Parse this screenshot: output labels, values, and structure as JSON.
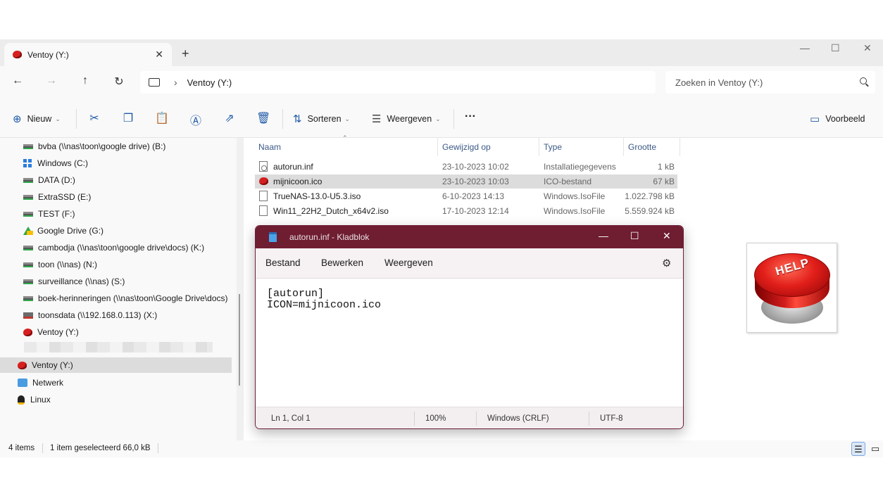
{
  "window": {
    "tab_title": "Ventoy (Y:)",
    "tab_close_glyph": "✕",
    "new_tab_glyph": "+",
    "minimize_glyph": "—",
    "maximize_glyph": "☐",
    "close_glyph": "✕"
  },
  "address": {
    "back_glyph": "←",
    "forward_glyph": "→",
    "up_glyph": "↑",
    "refresh_glyph": "↻",
    "separator": "›",
    "breadcrumb": "Ventoy (Y:)",
    "search_placeholder": "Zoeken in Ventoy (Y:)"
  },
  "toolbar": {
    "new_label": "Nieuw",
    "sort_label": "Sorteren",
    "view_label": "Weergeven",
    "more_glyph": "···",
    "preview_label": "Voorbeeld",
    "icons": [
      "cut-icon",
      "copy-icon",
      "paste-icon",
      "rename-icon",
      "share-icon",
      "delete-icon"
    ]
  },
  "sidebar": {
    "items": [
      {
        "label": "bvba (\\\\nas\\toon\\google drive) (B:)",
        "icon": "network-drive"
      },
      {
        "label": "Windows  (C:)",
        "icon": "windows-drive"
      },
      {
        "label": "DATA (D:)",
        "icon": "drive"
      },
      {
        "label": "ExtraSSD (E:)",
        "icon": "drive"
      },
      {
        "label": "TEST (F:)",
        "icon": "drive"
      },
      {
        "label": "Google Drive (G:)",
        "icon": "google-drive"
      },
      {
        "label": "cambodja (\\\\nas\\toon\\google drive\\docs) (K:)",
        "icon": "network-drive"
      },
      {
        "label": "toon (\\\\nas) (N:)",
        "icon": "network-drive"
      },
      {
        "label": "surveillance (\\\\nas) (S:)",
        "icon": "network-drive"
      },
      {
        "label": "boek-herinneringen (\\\\nas\\toon\\Google Drive\\docs)",
        "icon": "network-drive"
      },
      {
        "label": "toonsdata (\\\\192.168.0.113) (X:)",
        "icon": "disconnected-drive"
      },
      {
        "label": "Ventoy (Y:)",
        "icon": "ruby"
      }
    ],
    "tree": [
      {
        "label": "Ventoy (Y:)",
        "selected": true
      },
      {
        "label": "Netwerk"
      },
      {
        "label": "Linux"
      }
    ]
  },
  "filelist": {
    "columns": [
      "Naam",
      "Gewijzigd op",
      "Type",
      "Grootte"
    ],
    "rows": [
      {
        "name": "autorun.inf",
        "modified": "23-10-2023 10:02",
        "type": "Installatiegegevens",
        "size": "1 kB",
        "selected": false
      },
      {
        "name": "mijnicoon.ico",
        "modified": "23-10-2023 10:03",
        "type": "ICO-bestand",
        "size": "67 kB",
        "selected": true
      },
      {
        "name": "TrueNAS-13.0-U5.3.iso",
        "modified": "6-10-2023 14:13",
        "type": "Windows.IsoFile",
        "size": "1.022.798 kB",
        "selected": false
      },
      {
        "name": "Win11_22H2_Dutch_x64v2.iso",
        "modified": "17-10-2023 12:14",
        "type": "Windows.IsoFile",
        "size": "5.559.924 kB",
        "selected": false
      }
    ]
  },
  "statusbar": {
    "count": "4 items",
    "selection": "1 item geselecteerd  66,0 kB"
  },
  "notepad": {
    "title": "autorun.inf - Kladblok",
    "menu": [
      "Bestand",
      "Bewerken",
      "Weergeven"
    ],
    "content_line1": "[autorun]",
    "content_line2": "ICON=mijnicoon.ico",
    "status": {
      "position": "Ln 1, Col 1",
      "zoom": "100%",
      "line_ending": "Windows (CRLF)",
      "encoding": "UTF-8"
    }
  },
  "help_image": {
    "text": "HELP"
  },
  "colors": {
    "notepad_titlebar": "#6f1d31",
    "accent": "#1e5aa8",
    "selection": "#dcdcdc"
  }
}
